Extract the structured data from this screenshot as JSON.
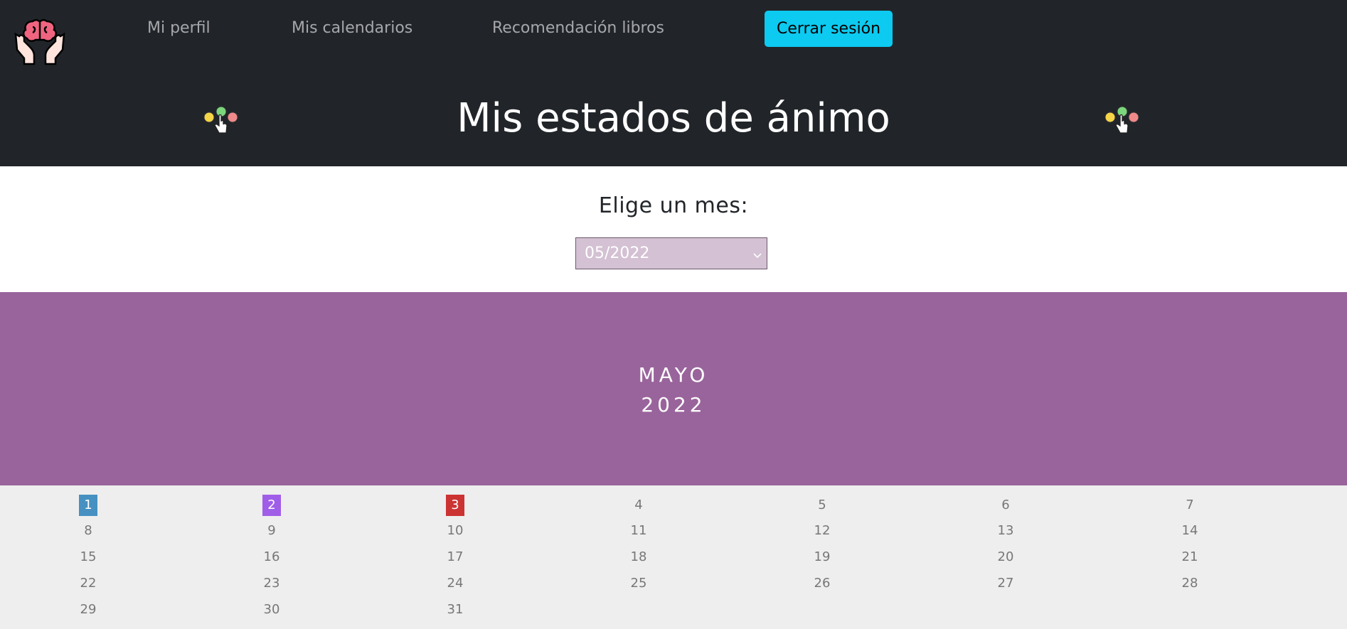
{
  "nav": {
    "links": [
      "Mi perfil",
      "Mis calendarios",
      "Recomendación libros"
    ],
    "logout_label": "Cerrar sesión"
  },
  "icons": {
    "logo": "hands-holding-brain-icon",
    "mood": "mood-faces-pointer-icon"
  },
  "header": {
    "title": "Mis estados de ánimo"
  },
  "chooser": {
    "label": "Elige un mes:",
    "selected": "05/2022"
  },
  "banner": {
    "month": "MAYO",
    "year": "2022"
  },
  "calendar": {
    "days": [
      {
        "label": "1",
        "mood_color": "#4691c1"
      },
      {
        "label": "2",
        "mood_color": "#a05ee8"
      },
      {
        "label": "3",
        "mood_color": "#cc3333"
      },
      {
        "label": "4"
      },
      {
        "label": "5"
      },
      {
        "label": "6"
      },
      {
        "label": "7"
      },
      {
        "label": "8"
      },
      {
        "label": "9"
      },
      {
        "label": "10"
      },
      {
        "label": "11"
      },
      {
        "label": "12"
      },
      {
        "label": "13"
      },
      {
        "label": "14"
      },
      {
        "label": "15"
      },
      {
        "label": "16"
      },
      {
        "label": "17"
      },
      {
        "label": "18"
      },
      {
        "label": "19"
      },
      {
        "label": "20"
      },
      {
        "label": "21"
      },
      {
        "label": "22"
      },
      {
        "label": "23"
      },
      {
        "label": "24"
      },
      {
        "label": "25"
      },
      {
        "label": "26"
      },
      {
        "label": "27"
      },
      {
        "label": "28"
      },
      {
        "label": "29"
      },
      {
        "label": "30"
      },
      {
        "label": "31"
      }
    ]
  },
  "colors": {
    "navbar": "#212529",
    "logout_button": "#0dcaf0",
    "select_background": "#d4c1d3",
    "banner": "#99649b",
    "calendar_background": "#eeeeee"
  }
}
